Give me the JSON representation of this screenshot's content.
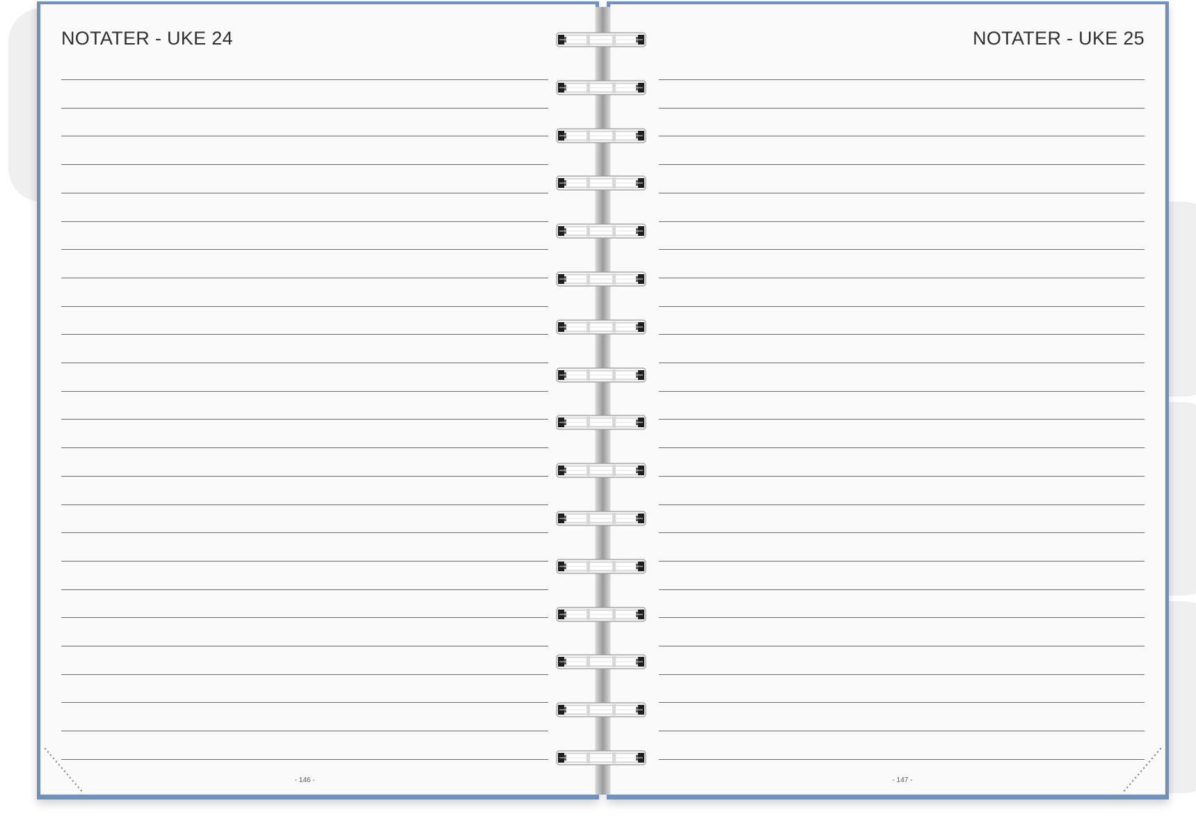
{
  "left_page": {
    "title": "NOTATER - UKE 24",
    "page_number": "- 146 -"
  },
  "right_page": {
    "title": "NOTATER - UKE 25",
    "page_number": "- 147 -"
  },
  "colors": {
    "cover": "#6f91bb",
    "paper": "#fafafa",
    "rule": "#6a6a6a",
    "tab": "#efefef"
  }
}
